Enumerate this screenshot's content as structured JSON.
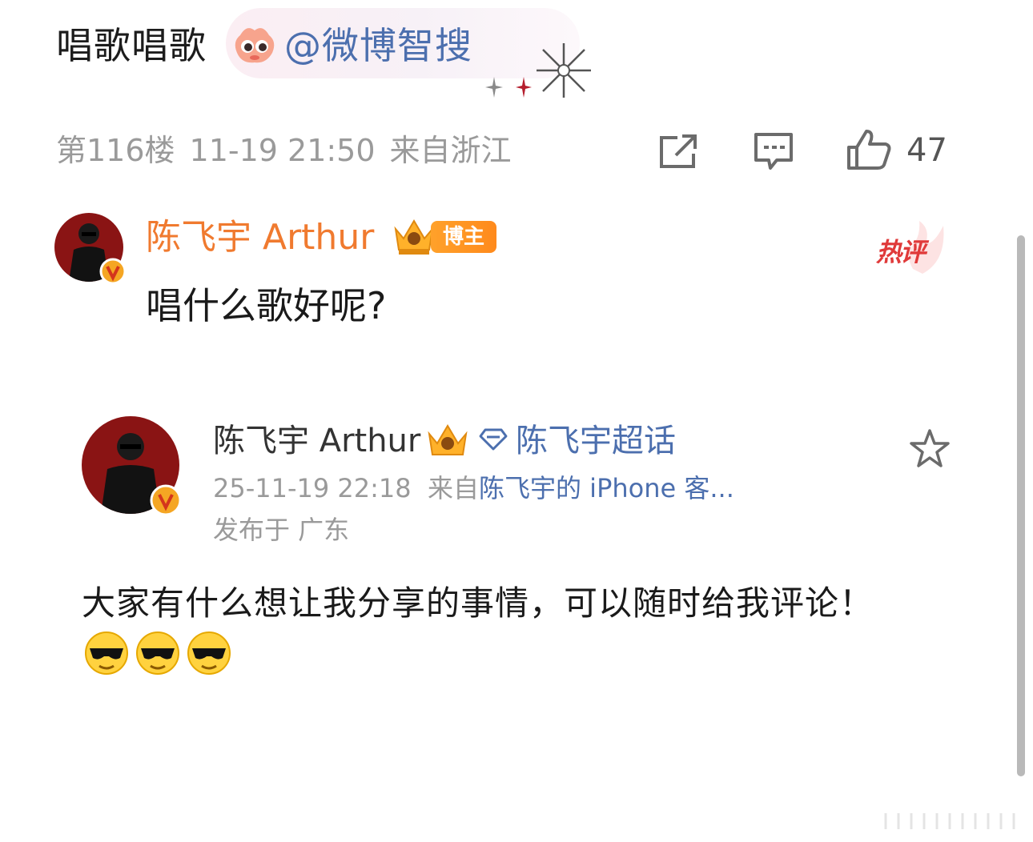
{
  "comment": {
    "text": "唱歌唱歌",
    "mention": "@微博智搜",
    "floor": "第116楼",
    "datetime": "11-19 21:50",
    "location": "来自浙江",
    "like_count": "47"
  },
  "blogger_reply": {
    "author": "陈飞宇 Arthur",
    "badge": "博主",
    "hot_label": "热评",
    "text": "唱什么歌好呢?"
  },
  "quoted_post": {
    "author": "陈飞宇 Arthur",
    "topic": "陈飞宇超话",
    "datetime": "25-11-19 22:18",
    "source_prefix": "来自",
    "source": "陈飞宇的 iPhone 客...",
    "location": "发布于 广东",
    "text": "大家有什么想让我分享的事情，可以随时给我评论！"
  },
  "icons": {
    "share": "share-icon",
    "comment": "comment-icon",
    "like": "thumbs-up-icon",
    "favorite": "star-icon"
  },
  "colors": {
    "link_blue": "#4c6fae",
    "blogger_orange": "#f07a2f",
    "hot_red": "#e03a3a",
    "meta_gray": "#9a9a9a"
  }
}
